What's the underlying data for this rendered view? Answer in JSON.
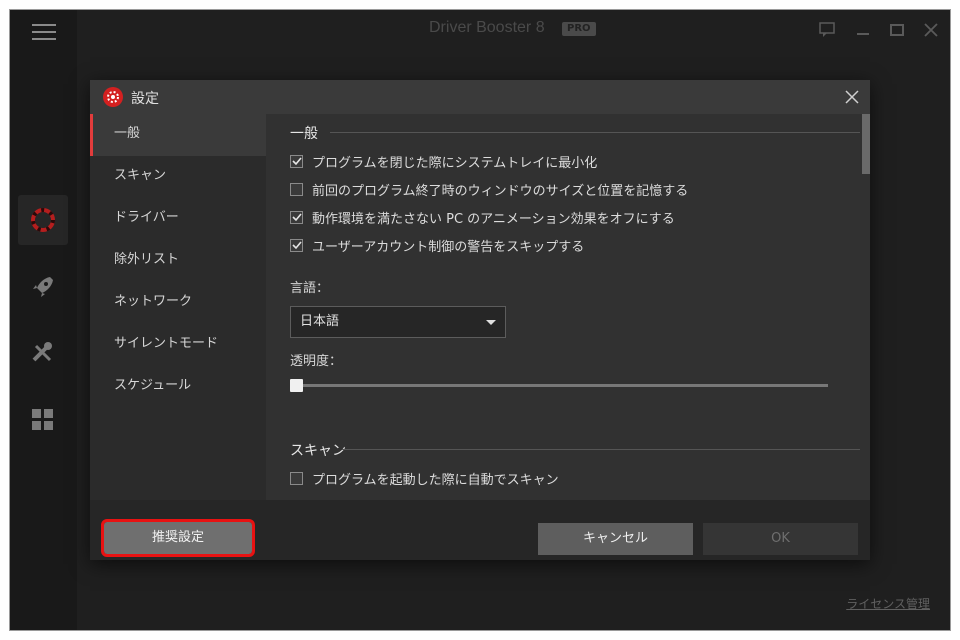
{
  "app": {
    "title": "Driver Booster 8",
    "badge": "PRO",
    "license_link": "ライセンス管理"
  },
  "dialog": {
    "title": "設定",
    "sidebar": [
      {
        "label": "一般",
        "active": true
      },
      {
        "label": "スキャン"
      },
      {
        "label": "ドライバー"
      },
      {
        "label": "除外リスト"
      },
      {
        "label": "ネットワーク"
      },
      {
        "label": "サイレントモード"
      },
      {
        "label": "スケジュール"
      }
    ],
    "general": {
      "section_title": "一般",
      "options": [
        {
          "label": "プログラムを閉じた際にシステムトレイに最小化",
          "checked": true
        },
        {
          "label": "前回のプログラム終了時のウィンドウのサイズと位置を記憶する",
          "checked": false
        },
        {
          "label": "動作環境を満たさない PC のアニメーション効果をオフにする",
          "checked": true
        },
        {
          "label": "ユーザーアカウント制御の警告をスキップする",
          "checked": true
        }
      ],
      "language_label": "言語：",
      "language_value": "日本語",
      "transparency_label": "透明度：",
      "transparency_value": 0
    },
    "scan": {
      "section_title": "スキャン",
      "options": [
        {
          "label": "プログラムを起動した際に自動でスキャン",
          "checked": false
        }
      ]
    },
    "footer": {
      "recommend_label": "推奨設定",
      "cancel_label": "キャンセル",
      "ok_label": "OK"
    }
  },
  "colors": {
    "accent": "#e23c3c",
    "highlight": "#e81212"
  }
}
